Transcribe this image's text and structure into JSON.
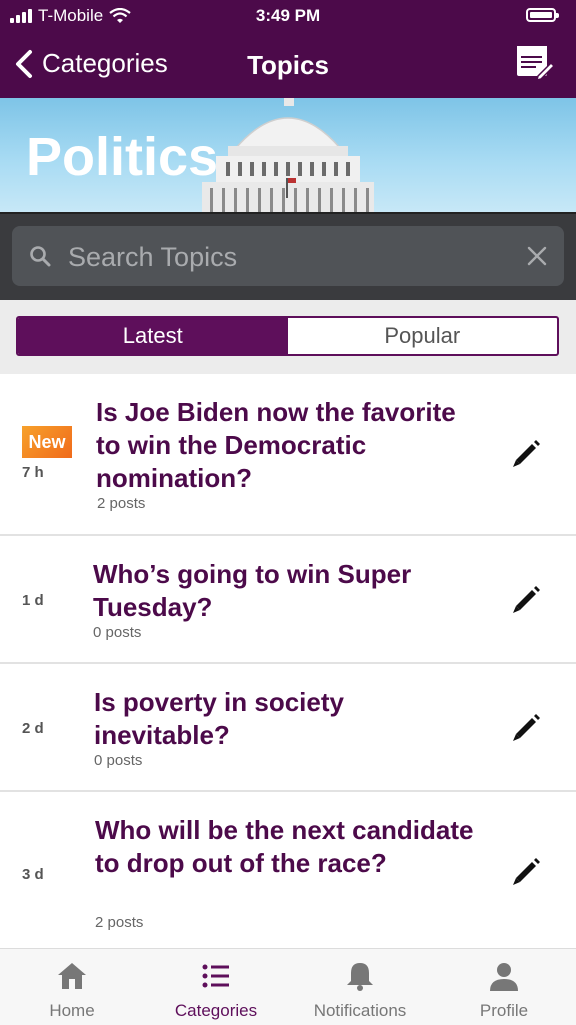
{
  "status_bar": {
    "carrier": "T-Mobile",
    "time": "3:49 PM"
  },
  "nav": {
    "back_label": "Categories",
    "title": "Topics"
  },
  "banner": {
    "title": "Politics"
  },
  "search": {
    "placeholder": "Search Topics",
    "value": ""
  },
  "segments": {
    "latest": "Latest",
    "popular": "Popular",
    "selected": "Latest"
  },
  "topics": [
    {
      "badge": "New",
      "age": "7 h",
      "title": "Is Joe Biden now the favorite to win the Democratic nomination?",
      "posts": "2 posts"
    },
    {
      "badge": "",
      "age": "1 d",
      "title": "Who’s going to win Super Tuesday?",
      "posts": "0 posts"
    },
    {
      "badge": "",
      "age": "2 d",
      "title": "Is poverty in society inevitable?",
      "posts": "0 posts"
    },
    {
      "badge": "",
      "age": "3 d",
      "title": "Who will be the next candidate to drop out of the race?",
      "posts": "2 posts"
    }
  ],
  "tabbar": {
    "home": "Home",
    "categories": "Categories",
    "notifications": "Notifications",
    "profile": "Profile",
    "active": "Categories"
  },
  "colors": {
    "brand": "#4c0a4a",
    "accent": "#5e0f5b",
    "badge": "#f07a1f"
  }
}
